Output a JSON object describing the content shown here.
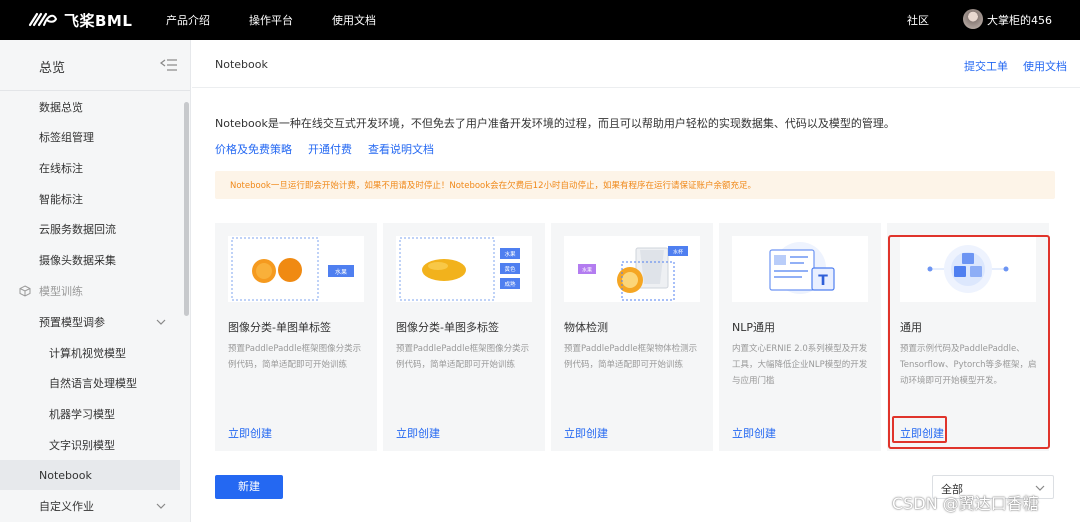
{
  "topbar": {
    "logo_text": "飞桨BML",
    "nav": [
      "产品介绍",
      "操作平台",
      "使用文档"
    ],
    "community": "社区",
    "username": "大掌柜的456"
  },
  "sidebar": {
    "title": "总览",
    "items": [
      {
        "label": "数据总览"
      },
      {
        "label": "标签组管理"
      },
      {
        "label": "在线标注"
      },
      {
        "label": "智能标注"
      },
      {
        "label": "云服务数据回流"
      },
      {
        "label": "摄像头数据采集"
      },
      {
        "label": "模型训练"
      },
      {
        "label": "预置模型调参"
      },
      {
        "label": "计算机视觉模型"
      },
      {
        "label": "自然语言处理模型"
      },
      {
        "label": "机器学习模型"
      },
      {
        "label": "文字识别模型"
      },
      {
        "label": "Notebook"
      },
      {
        "label": "自定义作业"
      }
    ]
  },
  "header": {
    "breadcrumb": "Notebook",
    "submit_ticket": "提交工单",
    "docs": "使用文档"
  },
  "main": {
    "intro": "Notebook是一种在线交互式开发环境，不但免去了用户准备开发环境的过程，而且可以帮助用户轻松的实现数据集、代码以及模型的管理。",
    "links": [
      "价格及免费策略",
      "开通付费",
      "查看说明文档"
    ],
    "warning": "Notebook一旦运行即会开始计费，如果不用请及时停止！Notebook会在欠费后12小时自动停止，如果有程序在运行请保证账户余额充足。",
    "cards": [
      {
        "title": "图像分类-单图单标签",
        "desc": "预置PaddlePaddle框架图像分类示例代码，简单适配即可开始训练",
        "action": "立即创建",
        "tags": [
          "水果"
        ]
      },
      {
        "title": "图像分类-单图多标签",
        "desc": "预置PaddlePaddle框架图像分类示例代码，简单适配即可开始训练",
        "action": "立即创建",
        "tags": [
          "水果",
          "黄色",
          "成熟"
        ]
      },
      {
        "title": "物体检测",
        "desc": "预置PaddlePaddle框架物体检测示例代码，简单适配即可开始训练",
        "action": "立即创建",
        "tags": [
          "水果",
          "水杯"
        ]
      },
      {
        "title": "NLP通用",
        "desc": "内置文心ERNIE 2.0系列模型及开发工具，大幅降低企业NLP模型的开发与应用门槛",
        "action": "立即创建",
        "tags": []
      },
      {
        "title": "通用",
        "desc": "预置示例代码及PaddlePaddle、Tensorflow、Pytorch等多框架，启动环境即可开始模型开发。",
        "action": "立即创建",
        "tags": []
      }
    ],
    "new_button": "新建",
    "filter_value": "全部"
  },
  "watermark": "CSDN @翼达口香糖",
  "colors": {
    "accent": "#2468f2",
    "warning_text": "#f0891a",
    "warning_bg": "#fdf4e8",
    "highlight": "#e0342b"
  }
}
